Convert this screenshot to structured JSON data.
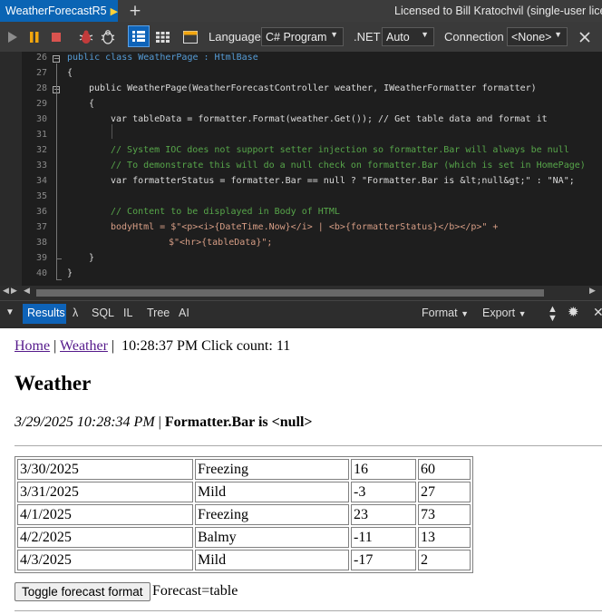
{
  "tab": {
    "title": "WeatherForecastR5"
  },
  "license": "Licensed to Bill Kratochvil (single-user licen",
  "toolbar": {
    "language_label": "Language",
    "language_value": "C# Program",
    "net_label": ".NET",
    "net_value": "Auto",
    "connection_label": "Connection",
    "connection_value": "<None>"
  },
  "editor": {
    "line_numbers": [
      "26",
      "27",
      "28",
      "29",
      "30",
      "31",
      "32",
      "33",
      "34",
      "35",
      "36",
      "37",
      "38",
      "39",
      "40"
    ],
    "lines": {
      "l26": "public class WeatherPage : HtmlBase",
      "l27": "{",
      "l28": "public WeatherPage(WeatherForecastController weather, IWeatherFormatter formatter)",
      "l29": "{",
      "l30": "var tableData = formatter.Format(weather.Get()); // Get table data and format it",
      "l32": "// System IOC does not support setter injection so formatter.Bar will always be null",
      "l33": "// To demonstrate this will do a null check on formatter.Bar (which is set in HomePage)",
      "l34": "var formatterStatus = formatter.Bar == null ? \"Formatter.Bar is &lt;null&gt;\" : \"NA\";",
      "l36": "// Content to be displayed in Body of HTML",
      "l37": "bodyHtml = $\"<p><i>{DateTime.Now}</i> | <b>{formatterStatus}</b></p>\" +",
      "l38": "$\"<hr>{tableData}\";",
      "l39": "}",
      "l40": "}"
    }
  },
  "results_bar": {
    "results": "Results",
    "lambda": "λ",
    "sql": "SQL",
    "il": "IL",
    "tree": "Tree",
    "ai": "AI",
    "format": "Format",
    "export": "Export"
  },
  "page": {
    "nav_home": "Home",
    "nav_sep1": "|",
    "nav_weather": "Weather",
    "nav_sep2": "|",
    "clock": "10:28:37 PM Click count: 11",
    "heading": "Weather",
    "timestamp": "3/29/2025 10:28:34 PM",
    "status_sep": "|",
    "formatter_status": "Formatter.Bar is <null>",
    "forecast_rows": [
      [
        "3/30/2025",
        "Freezing",
        "16",
        "60"
      ],
      [
        "3/31/2025",
        "Mild",
        "-3",
        "27"
      ],
      [
        "4/1/2025",
        "Freezing",
        "23",
        "73"
      ],
      [
        "4/2/2025",
        "Balmy",
        "-11",
        "13"
      ],
      [
        "4/3/2025",
        "Mild",
        "-17",
        "2"
      ]
    ],
    "toggle_button": "Toggle forecast format",
    "forecast_mode": "Forecast=table"
  }
}
